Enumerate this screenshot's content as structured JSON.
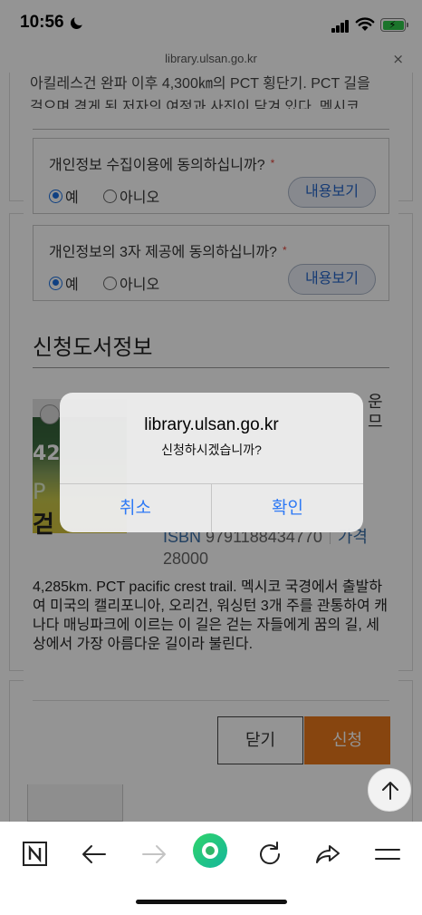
{
  "status_bar": {
    "time": "10:56"
  },
  "url_bar": {
    "url": "library.ulsan.go.kr",
    "close": "×"
  },
  "background": {
    "article_lines": [
      "아킬레스건 완파 이후 4,300㎞의 PCT 횡단기. PCT 길을",
      "걸으며 겪게 된 저자의 여정과 사진이 담겨 있다. 멕시코"
    ]
  },
  "form": {
    "consent_items": [
      {
        "question": "개인정보 수집이용에 동의하십니까?",
        "required": "*",
        "yes": "예",
        "no": "아니오",
        "selected": "yes",
        "view_label": "내용보기"
      },
      {
        "question": "개인정보의 3자 제공에 동의하십니까?",
        "required": "*",
        "yes": "예",
        "no": "아니오",
        "selected": "yes",
        "view_label": "내용보기"
      }
    ],
    "section_title": "신청도서정보",
    "book": {
      "cover_text": {
        "number": "42",
        "mid": "P",
        "bottom": "걷"
      },
      "title_fragment": "운",
      "title_fragment2": "므",
      "isbn_label": "ISBN",
      "isbn": "9791188434770",
      "price_label": "가격",
      "price": "28000",
      "description": "4,285km. PCT pacific crest trail. 멕시코 국경에서 출발하여 미국의 캘리포니아, 오리건, 워싱턴 3개 주를 관통하여 캐나다 매닝파크에 이르는 이 길은 걷는 자들에게 꿈의 길, 세상에서 가장 아름다운 길이라 불린다."
    },
    "close_label": "닫기",
    "apply_label": "신청"
  },
  "alert": {
    "title": "library.ulsan.go.kr",
    "message": "신청하시겠습니까?",
    "cancel": "취소",
    "confirm": "확인"
  },
  "colors": {
    "accent": "#e9771a",
    "link": "#2f7af5",
    "radio": "#1a6fe0",
    "battery": "#30c94a"
  },
  "toolbar": {
    "icons": [
      "naver-n-icon",
      "back-arrow-icon",
      "forward-arrow-icon",
      "green-circle-icon",
      "reload-icon",
      "share-icon",
      "menu-icon"
    ]
  }
}
